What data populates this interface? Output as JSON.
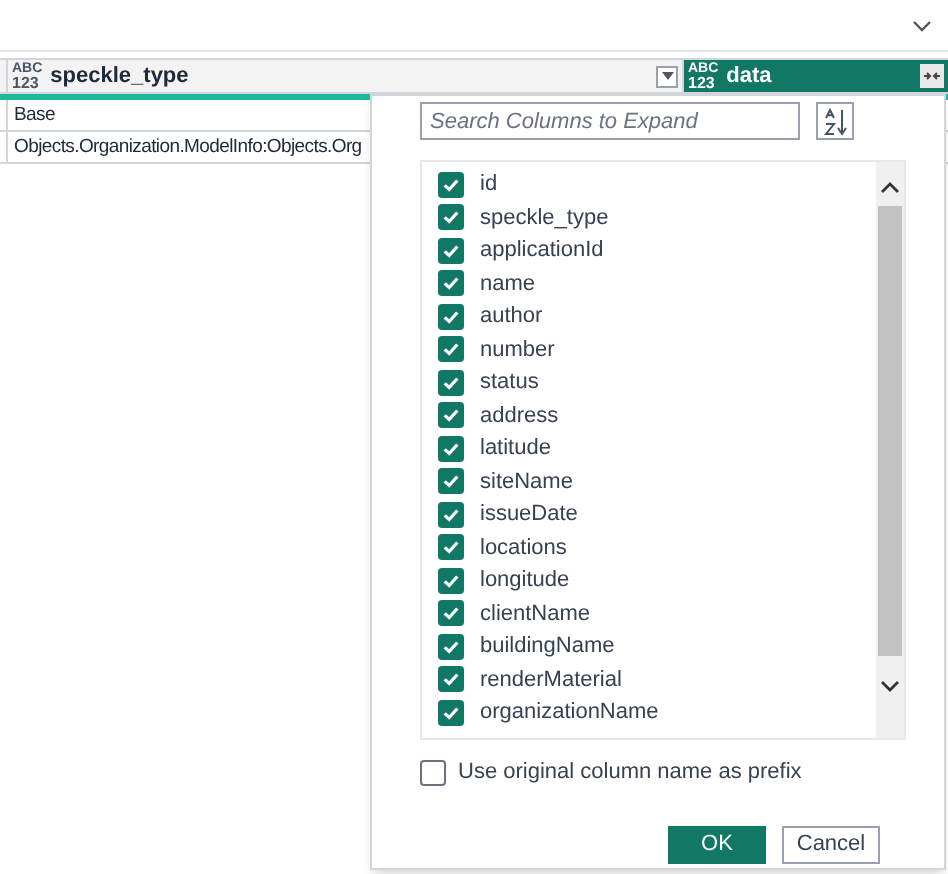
{
  "table": {
    "columns": [
      {
        "type_badge": "ABC 123",
        "name": "speckle_type",
        "selected": false
      },
      {
        "type_badge": "ABC 123",
        "name": "data",
        "selected": true
      }
    ],
    "rows": [
      "Base",
      "Objects.Organization.ModelInfo:Objects.Org"
    ]
  },
  "expand_panel": {
    "search": {
      "placeholder": "Search Columns to Expand"
    },
    "columns": [
      {
        "label": "id",
        "checked": true
      },
      {
        "label": "speckle_type",
        "checked": true
      },
      {
        "label": "applicationId",
        "checked": true
      },
      {
        "label": "name",
        "checked": true
      },
      {
        "label": "author",
        "checked": true
      },
      {
        "label": "number",
        "checked": true
      },
      {
        "label": "status",
        "checked": true
      },
      {
        "label": "address",
        "checked": true
      },
      {
        "label": "latitude",
        "checked": true
      },
      {
        "label": "siteName",
        "checked": true
      },
      {
        "label": "issueDate",
        "checked": true
      },
      {
        "label": "locations",
        "checked": true
      },
      {
        "label": "longitude",
        "checked": true
      },
      {
        "label": "clientName",
        "checked": true
      },
      {
        "label": "buildingName",
        "checked": true
      },
      {
        "label": "renderMaterial",
        "checked": true
      },
      {
        "label": "organizationName",
        "checked": true
      }
    ],
    "prefix": {
      "label": "Use original column name as prefix",
      "checked": false
    },
    "buttons": [
      {
        "label": "OK",
        "kind": "primary"
      },
      {
        "label": "Cancel",
        "kind": "secondary"
      }
    ]
  }
}
